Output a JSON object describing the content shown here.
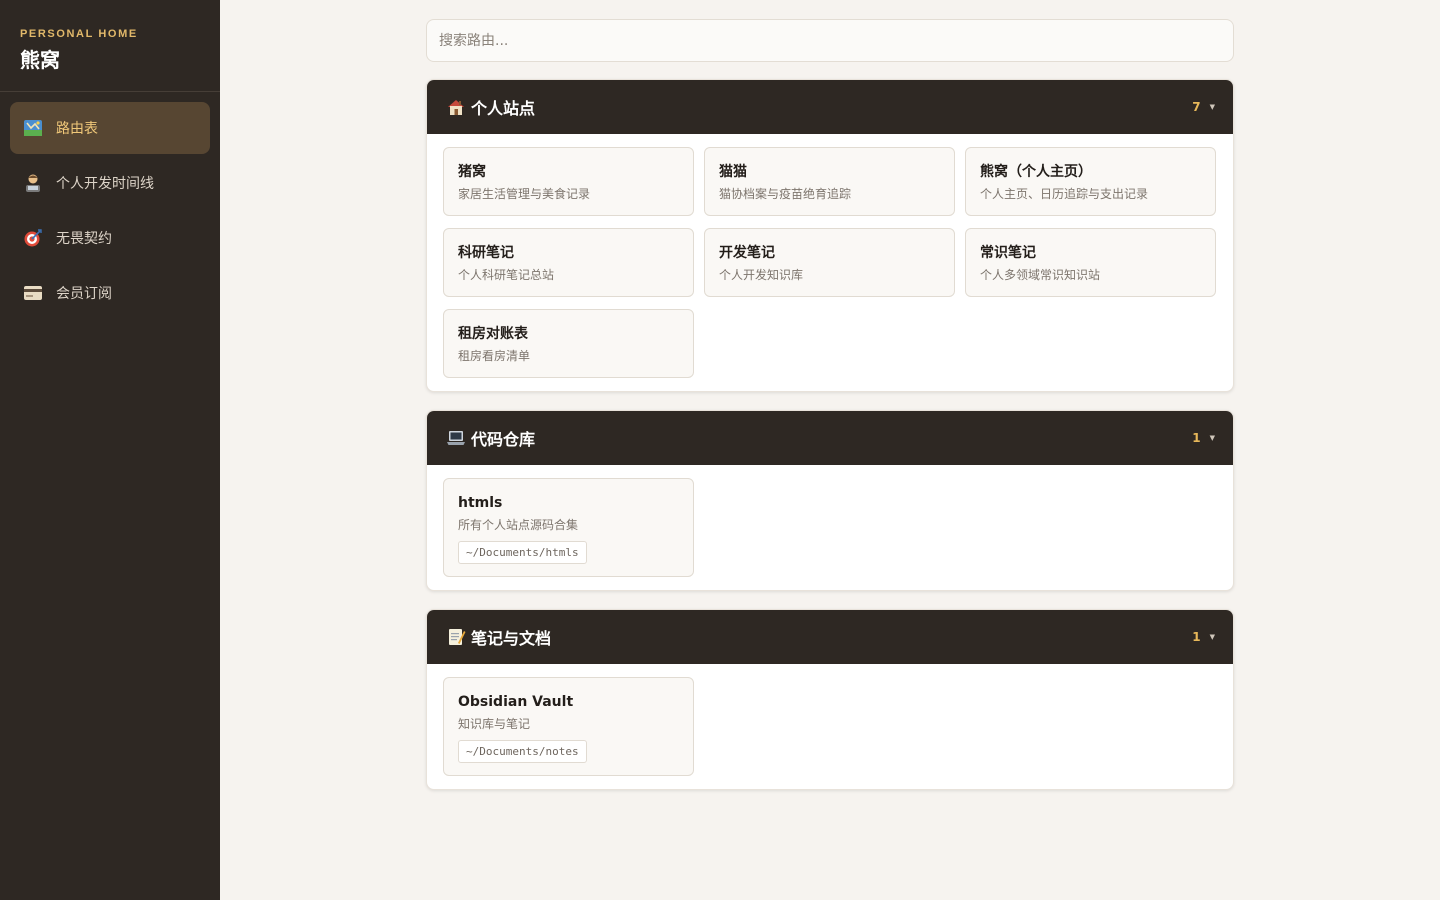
{
  "brand": {
    "subtitle": "PERSONAL HOME",
    "title": "熊窝"
  },
  "nav": [
    {
      "label": "路由表",
      "icon": "map-icon",
      "active": true
    },
    {
      "label": "个人开发时间线",
      "icon": "developer-icon",
      "active": false
    },
    {
      "label": "无畏契约",
      "icon": "target-icon",
      "active": false
    },
    {
      "label": "会员订阅",
      "icon": "credit-card-icon",
      "active": false
    }
  ],
  "search": {
    "placeholder": "搜索路由..."
  },
  "sections": [
    {
      "title": "个人站点",
      "icon": "house-icon",
      "count": "7",
      "cards": [
        {
          "title": "猪窝",
          "desc": "家居生活管理与美食记录"
        },
        {
          "title": "猫猫",
          "desc": "猫协档案与疫苗绝育追踪"
        },
        {
          "title": "熊窝（个人主页）",
          "desc": "个人主页、日历追踪与支出记录"
        },
        {
          "title": "科研笔记",
          "desc": "个人科研笔记总站"
        },
        {
          "title": "开发笔记",
          "desc": "个人开发知识库"
        },
        {
          "title": "常识笔记",
          "desc": "个人多领域常识知识站"
        },
        {
          "title": "租房对账表",
          "desc": "租房看房清单"
        }
      ]
    },
    {
      "title": "代码仓库",
      "icon": "laptop-icon",
      "count": "1",
      "cards": [
        {
          "title": "htmls",
          "desc": "所有个人站点源码合集",
          "path": "~/Documents/htmls"
        }
      ]
    },
    {
      "title": "笔记与文档",
      "icon": "memo-icon",
      "count": "1",
      "cards": [
        {
          "title": "Obsidian Vault",
          "desc": "知识库与笔记",
          "path": "~/Documents/notes"
        }
      ]
    }
  ],
  "colors": {
    "sidebar": "#2e2823",
    "accent": "#e7b85a",
    "active_bg": "#574632",
    "page_bg": "#f6f3ef"
  }
}
